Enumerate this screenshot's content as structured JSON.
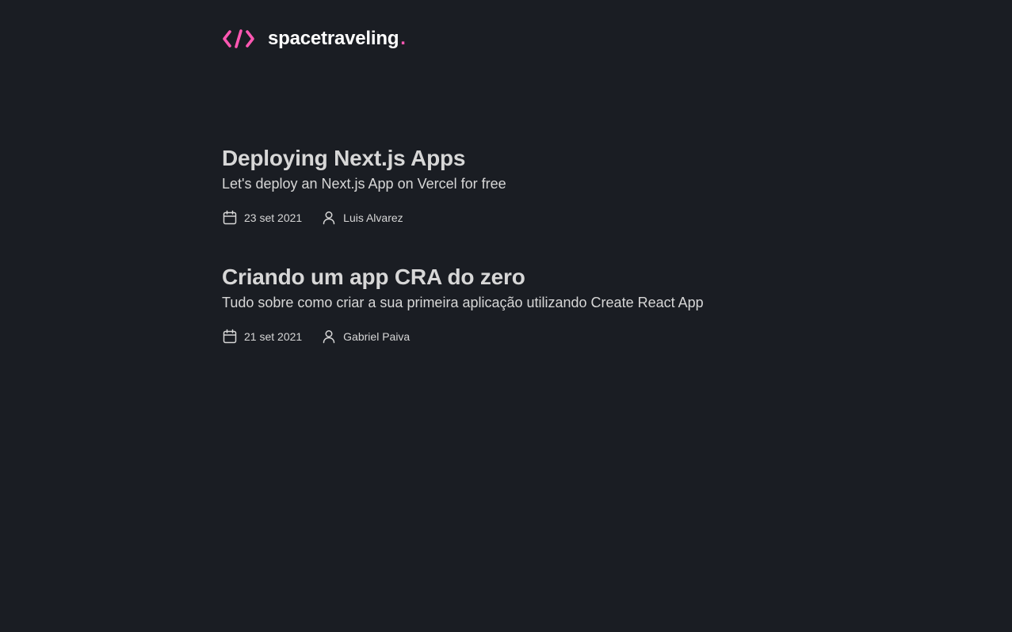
{
  "header": {
    "logo_text": "spacetraveling",
    "logo_dot": ".",
    "logo_icon": "code-brackets-icon",
    "accent_color": "#ff57b2"
  },
  "posts": [
    {
      "title": "Deploying Next.js Apps",
      "subtitle": "Let's deploy an Next.js App on Vercel for free",
      "date": "23 set 2021",
      "author": "Luis Alvarez",
      "date_icon": "calendar-icon",
      "author_icon": "user-icon"
    },
    {
      "title": "Criando um app CRA do zero",
      "subtitle": "Tudo sobre como criar a sua primeira aplicação utilizando Create React App",
      "date": "21 set 2021",
      "author": "Gabriel Paiva",
      "date_icon": "calendar-icon",
      "author_icon": "user-icon"
    }
  ],
  "colors": {
    "background": "#1a1d23",
    "text": "#d7d7d7",
    "heading": "#ffffff"
  }
}
